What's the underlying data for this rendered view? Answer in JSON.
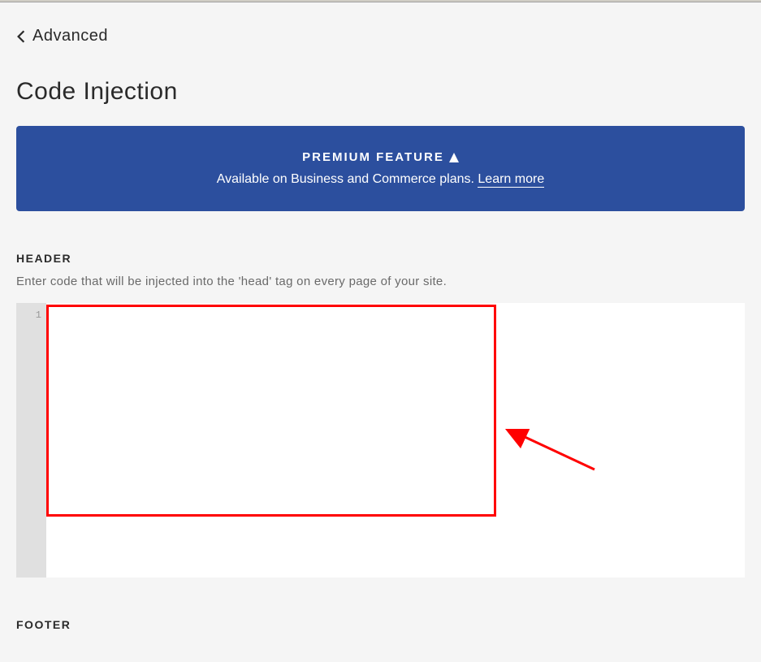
{
  "breadcrumb": {
    "label": "Advanced"
  },
  "page": {
    "title": "Code Injection"
  },
  "premium_banner": {
    "title": "PREMIUM FEATURE",
    "subtitle": "Available on Business and Commerce plans. ",
    "learn_more": "Learn more"
  },
  "sections": {
    "header": {
      "label": "HEADER",
      "description": "Enter code that will be injected into the 'head' tag on every page of your site.",
      "line_number": "1"
    },
    "footer": {
      "label": "FOOTER"
    }
  }
}
